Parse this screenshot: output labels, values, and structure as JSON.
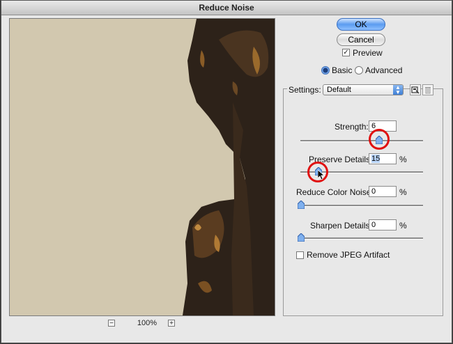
{
  "window": {
    "title": "Reduce Noise"
  },
  "buttons": {
    "ok": "OK",
    "cancel": "Cancel"
  },
  "preview_toggle": {
    "label": "Preview",
    "checked": true
  },
  "mode": {
    "basic": "Basic",
    "advanced": "Advanced",
    "selected": "Basic"
  },
  "settings": {
    "label": "Settings:",
    "value": "Default",
    "save_icon": "save-settings-icon",
    "delete_icon": "trash-icon"
  },
  "controls": {
    "strength": {
      "label": "Strength:",
      "value": "6",
      "unit": "",
      "max": 10
    },
    "preserve_details": {
      "label": "Preserve Details:",
      "value": "15",
      "unit": "%",
      "max": 100
    },
    "reduce_color_noise": {
      "label": "Reduce Color Noise:",
      "value": "0",
      "unit": "%",
      "max": 100
    },
    "sharpen_details": {
      "label": "Sharpen Details:",
      "value": "0",
      "unit": "%",
      "max": 100
    }
  },
  "jpeg": {
    "label": "Remove JPEG Artifact",
    "checked": false
  },
  "zoom": {
    "level": "100%",
    "minus": "−",
    "plus": "+"
  },
  "colors": {
    "highlight": "#e01010",
    "accent": "#5b9cf0"
  }
}
